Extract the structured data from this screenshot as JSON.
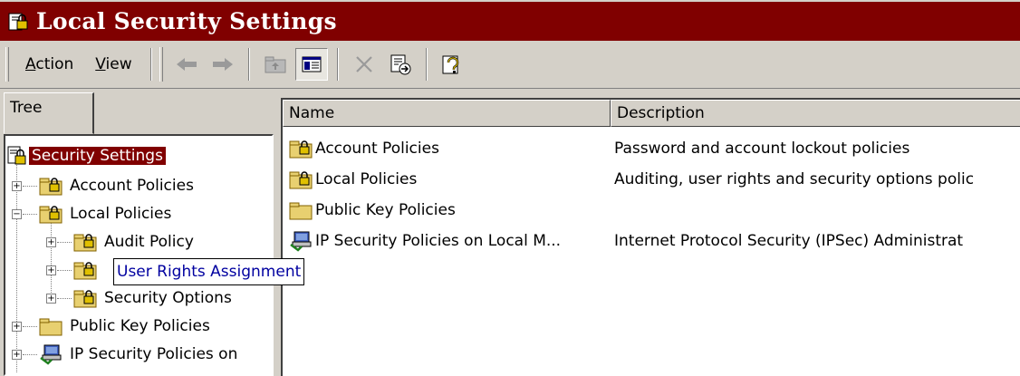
{
  "window": {
    "title": "Local Security Settings",
    "title_icon": "security-settings-icon",
    "colors": {
      "title_bar": "#800000",
      "face": "#d4d0c8",
      "selection": "#800000"
    }
  },
  "menu": {
    "items": [
      {
        "label_pre": "",
        "label_ul": "A",
        "label_post": "ction"
      },
      {
        "label_pre": "",
        "label_ul": "V",
        "label_post": "iew"
      }
    ]
  },
  "toolbar": {
    "buttons": [
      "back-arrow-icon",
      "forward-arrow-icon",
      "up-folder-icon",
      "show-hide-tree-icon",
      "delete-icon",
      "export-list-icon",
      "help-icon"
    ]
  },
  "tree": {
    "tab_label": "Tree",
    "items": [
      {
        "label": "Security Settings",
        "icon": "security-settings-icon"
      },
      {
        "label": "Account Policies",
        "icon": "locked-folder-icon",
        "expander": "+"
      },
      {
        "label": "Local Policies",
        "icon": "locked-folder-icon",
        "expander": "−"
      },
      {
        "label": "Audit Policy",
        "icon": "locked-folder-icon",
        "expander": "+"
      },
      {
        "label": "User Rights Assignment",
        "icon": "locked-folder-icon",
        "expander": "+"
      },
      {
        "label": "Security Options",
        "icon": "locked-folder-icon",
        "expander": "+"
      },
      {
        "label": "Public Key Policies",
        "icon": "folder-icon",
        "expander": "+"
      },
      {
        "label": "IP Security Policies on",
        "icon": "ip-security-icon",
        "expander": "+"
      }
    ]
  },
  "list": {
    "columns": [
      "Name",
      "Description"
    ],
    "rows": [
      {
        "name": "Account Policies",
        "description": "Password and account lockout policies",
        "icon": "locked-folder-icon"
      },
      {
        "name": "Local Policies",
        "description": "Auditing, user rights and security options polic",
        "icon": "locked-folder-icon"
      },
      {
        "name": "Public Key Policies",
        "description": "",
        "icon": "folder-icon"
      },
      {
        "name": "IP Security Policies on Local M...",
        "description": "Internet Protocol Security (IPSec) Administrat",
        "icon": "ip-security-icon"
      }
    ]
  }
}
